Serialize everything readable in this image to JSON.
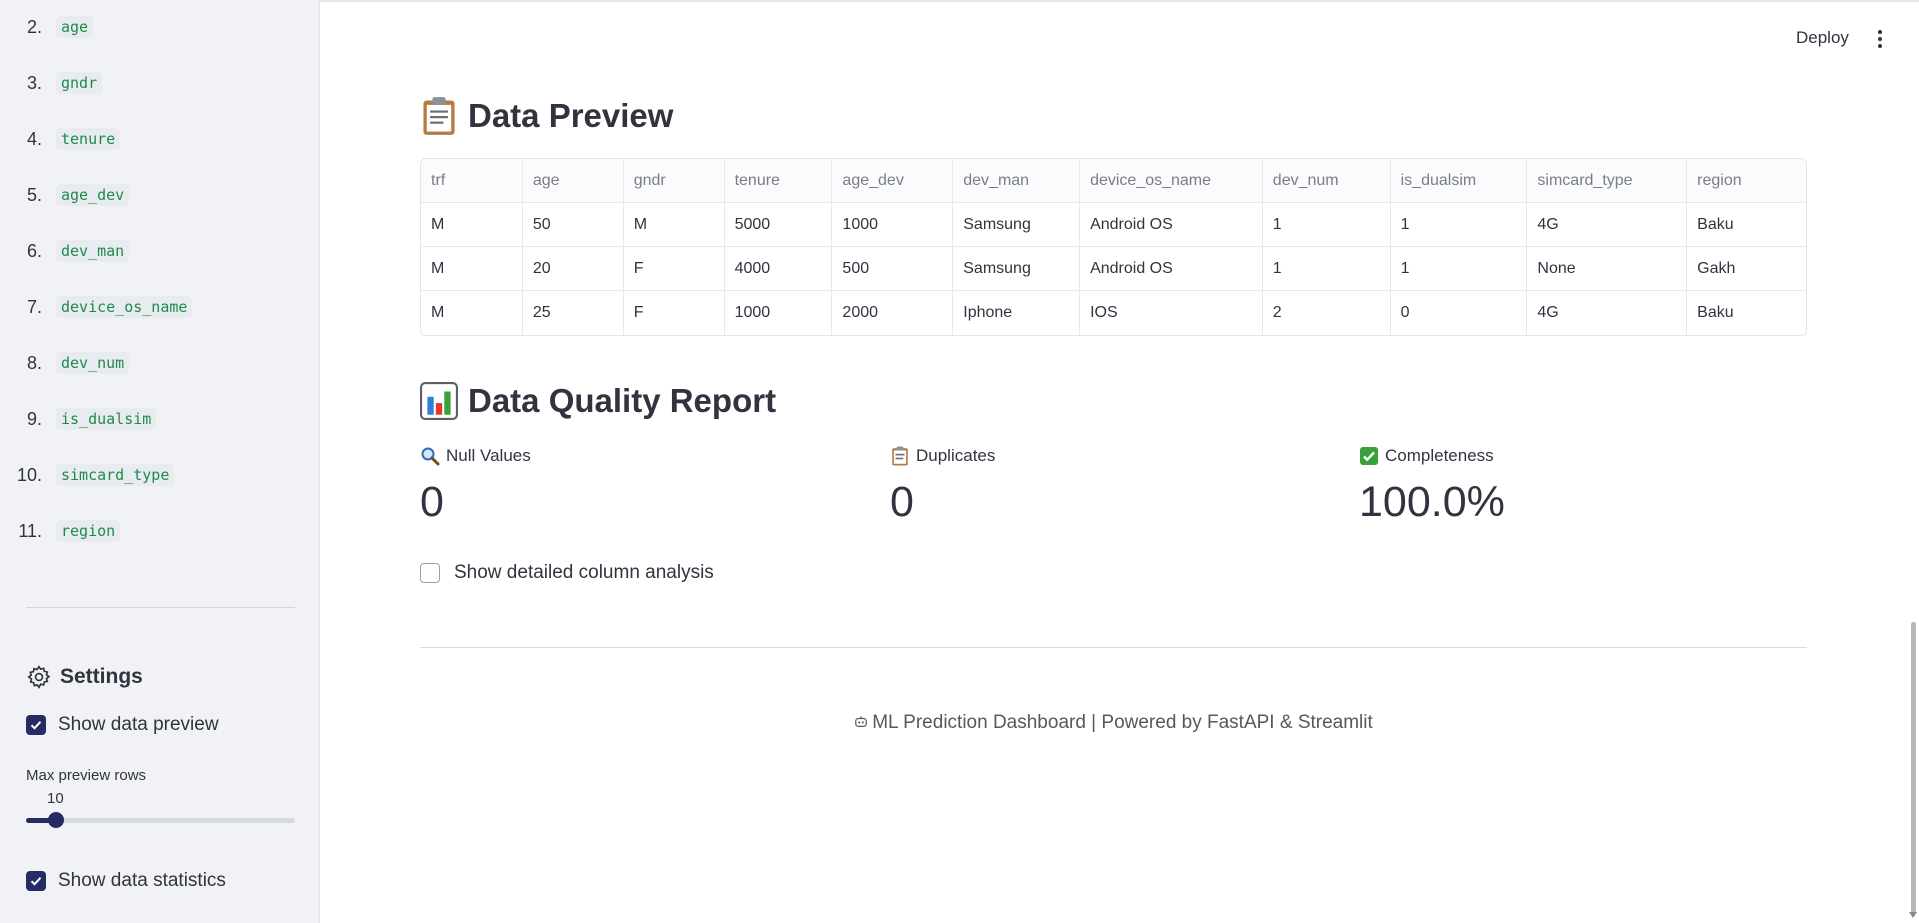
{
  "sidebar": {
    "columns": [
      {
        "num": "2.",
        "name": "age"
      },
      {
        "num": "3.",
        "name": "gndr"
      },
      {
        "num": "4.",
        "name": "tenure"
      },
      {
        "num": "5.",
        "name": "age_dev"
      },
      {
        "num": "6.",
        "name": "dev_man"
      },
      {
        "num": "7.",
        "name": "device_os_name"
      },
      {
        "num": "8.",
        "name": "dev_num"
      },
      {
        "num": "9.",
        "name": "is_dualsim"
      },
      {
        "num": "10.",
        "name": "simcard_type"
      },
      {
        "num": "11.",
        "name": "region"
      }
    ],
    "settings_title": "Settings",
    "show_preview_label": "Show data preview",
    "show_preview_checked": true,
    "max_rows_label": "Max preview rows",
    "max_rows_value": "10",
    "max_rows_fraction": 0.11,
    "show_stats_label": "Show data statistics",
    "show_stats_checked": true
  },
  "header": {
    "deploy_label": "Deploy",
    "menu_icon": "kebab-menu-icon"
  },
  "preview": {
    "title": "Data Preview",
    "icon": "clipboard-icon",
    "columns": [
      "trf",
      "age",
      "gndr",
      "tenure",
      "age_dev",
      "dev_man",
      "device_os_name",
      "dev_num",
      "is_dualsim",
      "simcard_type",
      "region"
    ],
    "rows": [
      [
        "M",
        "50",
        "M",
        "5000",
        "1000",
        "Samsung",
        "Android OS",
        "1",
        "1",
        "4G",
        "Baku"
      ],
      [
        "M",
        "20",
        "F",
        "4000",
        "500",
        "Samsung",
        "Android OS",
        "1",
        "1",
        "None",
        "Gakh"
      ],
      [
        "M",
        "25",
        "F",
        "1000",
        "2000",
        "Iphone",
        "IOS",
        "2",
        "0",
        "4G",
        "Baku"
      ]
    ]
  },
  "quality": {
    "title": "Data Quality Report",
    "icon": "bar-chart-icon",
    "metrics": [
      {
        "icon": "magnifier-icon",
        "label": "Null Values",
        "value": "0"
      },
      {
        "icon": "clipboard-icon",
        "label": "Duplicates",
        "value": "0"
      },
      {
        "icon": "check-box-icon",
        "label": "Completeness",
        "value": "100.0%"
      }
    ],
    "detail_label": "Show detailed column analysis",
    "detail_checked": false
  },
  "footer": {
    "text": "ML Prediction Dashboard | Powered by FastAPI & Streamlit",
    "icon": "robot-icon"
  },
  "colors": {
    "accent": "#262c63",
    "code_text": "#1f8a4c",
    "sidebar_bg": "#f0f2f6"
  }
}
